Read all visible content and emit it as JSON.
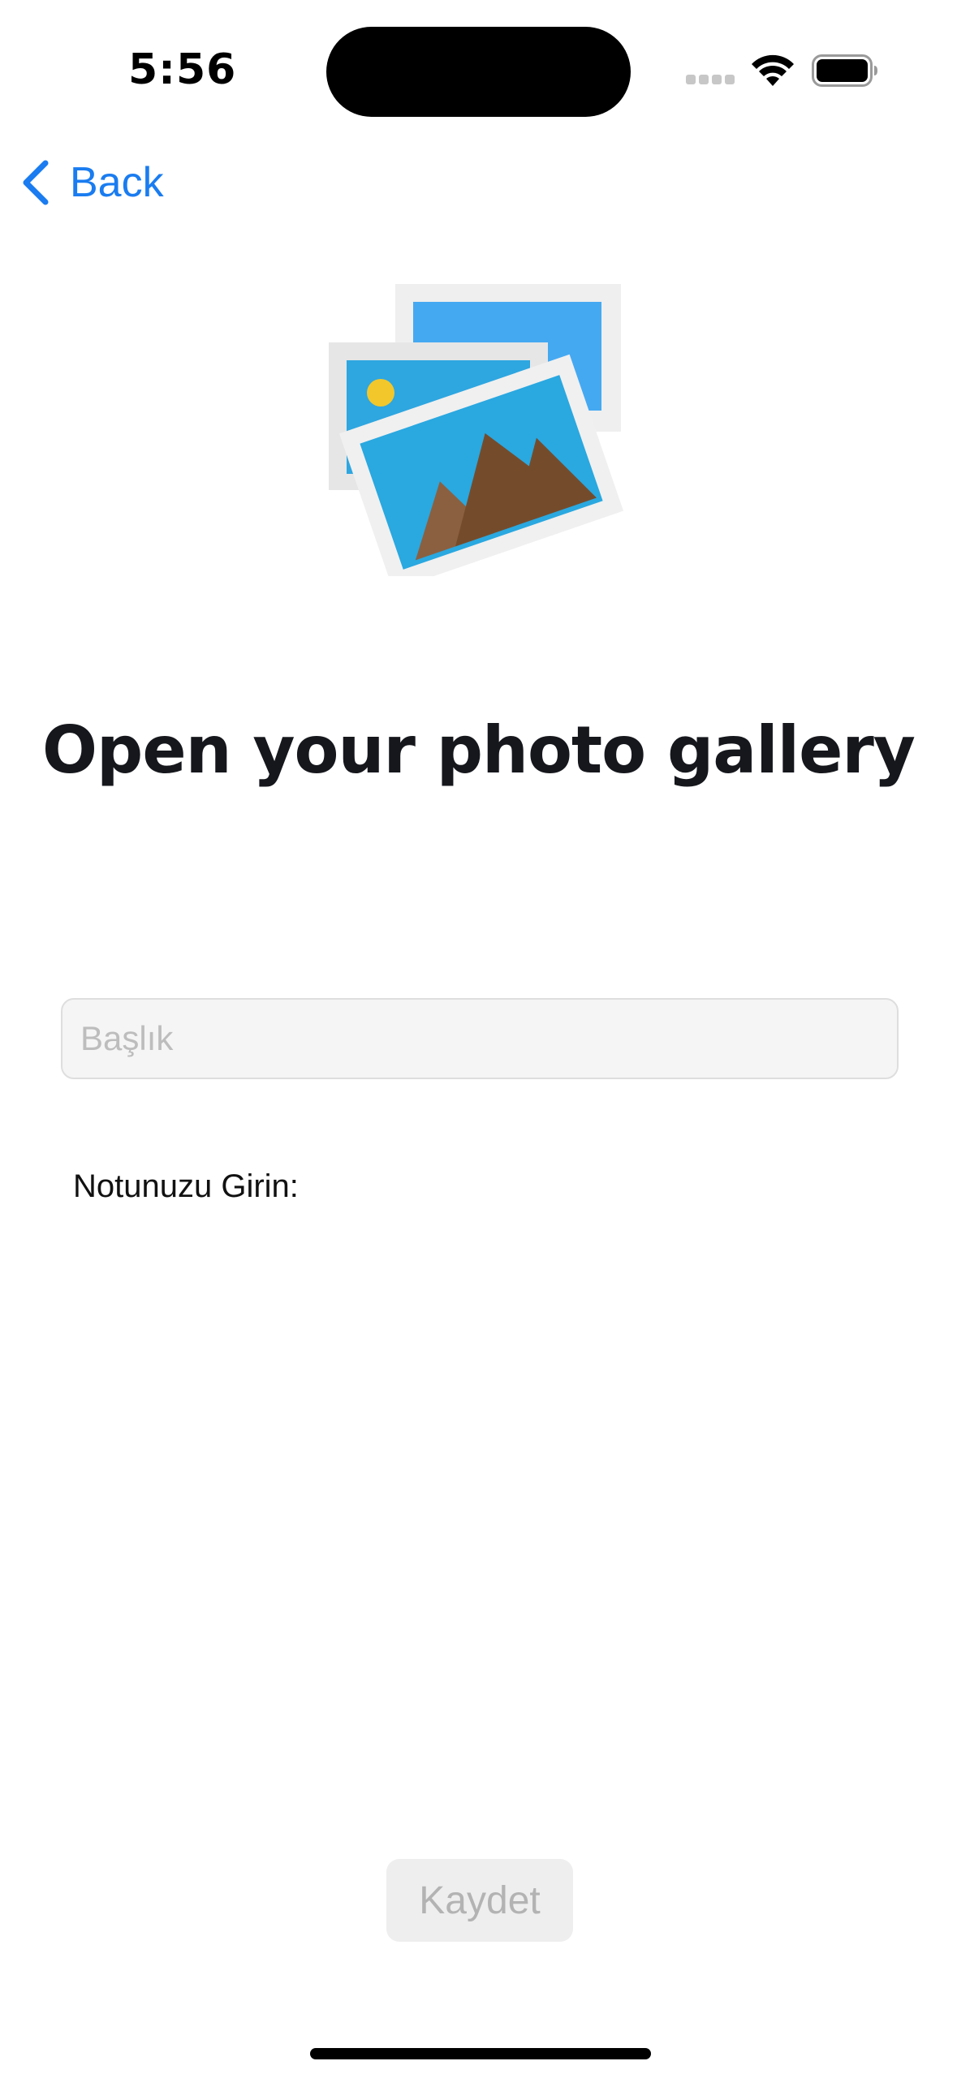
{
  "status_bar": {
    "time": "5:56"
  },
  "nav": {
    "back_label": "Back",
    "back_icon": "chevron-left-icon"
  },
  "illustration": {
    "icon": "photo-gallery-icon"
  },
  "main": {
    "title": "Open your photo gallery",
    "title_field": {
      "placeholder": "Başlık",
      "value": ""
    },
    "note_label": "Notunuzu Girin:",
    "save_label": "Kaydet"
  },
  "colors": {
    "accent": "#1a7cf0",
    "disabled_button_bg": "#eeeeee",
    "disabled_button_text": "#b3b3b3"
  }
}
